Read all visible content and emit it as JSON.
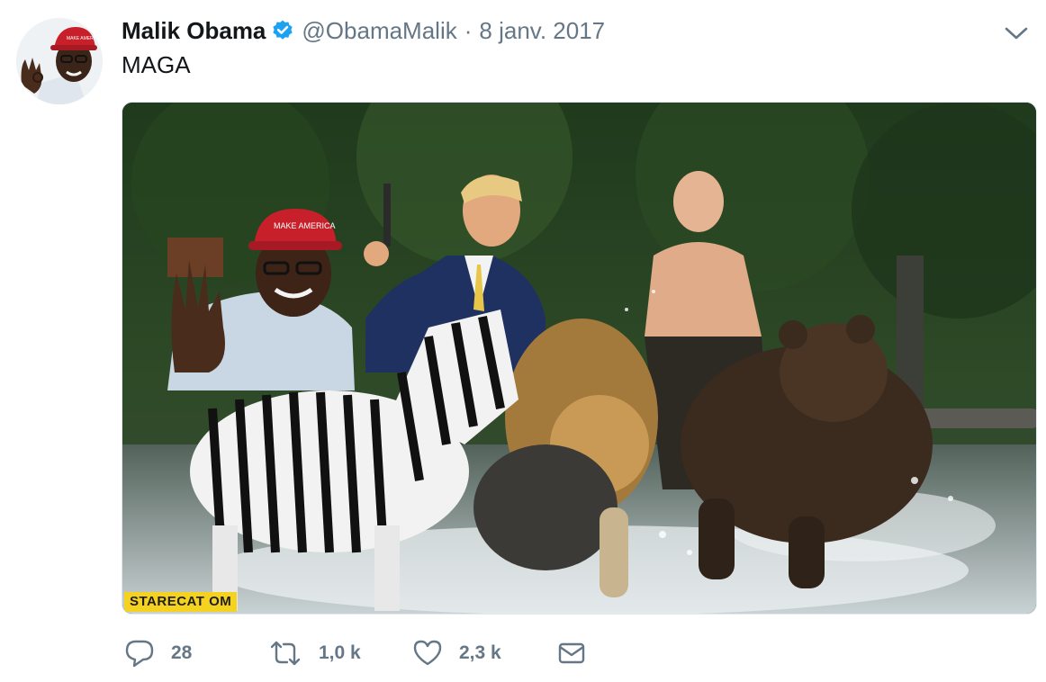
{
  "tweet": {
    "author_name": "Malik Obama",
    "handle": "@ObamaMalik",
    "separator": "·",
    "date": "8 janv. 2017",
    "text": "MAGA",
    "verified": true
  },
  "media": {
    "watermark_text": "STARECAT    OM"
  },
  "actions": {
    "reply_count": "28",
    "retweet_count": "1,0 k",
    "like_count": "2,3 k"
  },
  "icons": {
    "verified": "verified-badge-icon",
    "caret": "chevron-down-icon",
    "reply": "reply-icon",
    "retweet": "retweet-icon",
    "like": "heart-icon",
    "dm": "envelope-icon"
  },
  "colors": {
    "primary_text": "#14171a",
    "secondary_text": "#657786",
    "verified_blue": "#1da1f2",
    "hat_red": "#c8202b"
  }
}
